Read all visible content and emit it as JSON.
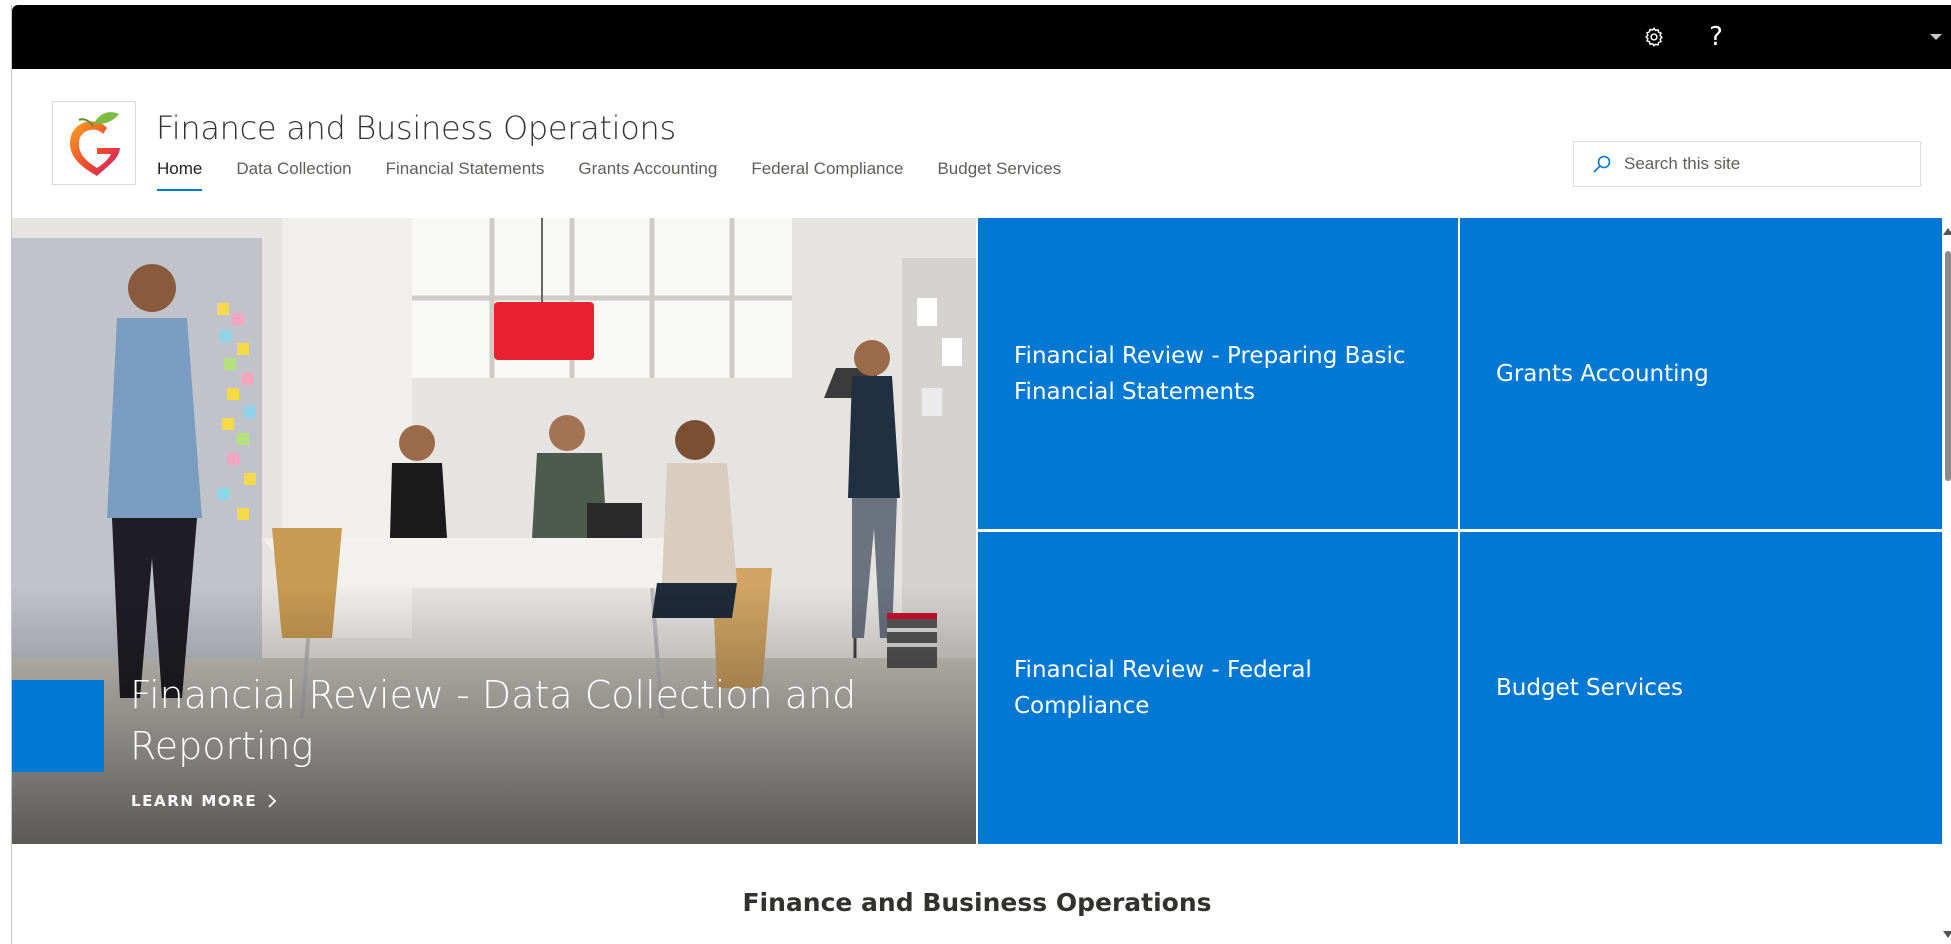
{
  "suite_bar": {
    "settings_icon": "gear-icon",
    "help_label": "?"
  },
  "site": {
    "title": "Finance and Business Operations",
    "logo_icon": "g-heart-logo"
  },
  "nav": {
    "items": [
      {
        "label": "Home",
        "active": true
      },
      {
        "label": "Data Collection",
        "active": false
      },
      {
        "label": "Financial Statements",
        "active": false
      },
      {
        "label": "Grants Accounting",
        "active": false
      },
      {
        "label": "Federal Compliance",
        "active": false
      },
      {
        "label": "Budget Services",
        "active": false
      }
    ]
  },
  "search": {
    "placeholder": "Search this site",
    "value": "",
    "icon": "search-icon"
  },
  "hero": {
    "main_title": "Financial Review - Data Collection and Reporting",
    "link_label": "LEARN MORE",
    "tiles": [
      {
        "label": "Financial Review - Preparing Basic Financial Statements"
      },
      {
        "label": "Grants Accounting"
      },
      {
        "label": "Financial Review - Federal Compliance"
      },
      {
        "label": "Budget Services"
      }
    ]
  },
  "section": {
    "title": "Finance and Business Operations"
  },
  "colors": {
    "accent": "#0078d4",
    "suite_bar": "#000000",
    "text": "#323130"
  }
}
